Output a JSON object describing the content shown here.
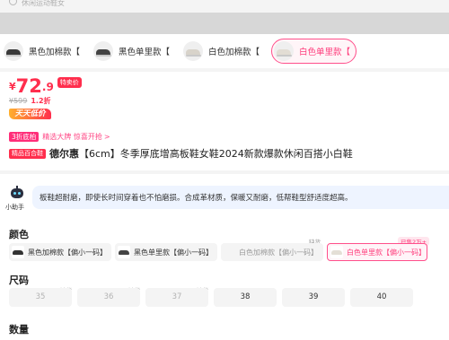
{
  "search": {
    "placeholder": "休闲运动鞋女"
  },
  "variant_strip": {
    "items": [
      {
        "label": "黑色加棉款【",
        "shoe_color": "#3a3a3a",
        "selected": false
      },
      {
        "label": "黑色单里款【",
        "shoe_color": "#444444",
        "selected": false
      },
      {
        "label": "白色加棉款【",
        "shoe_color": "#e8e4dc",
        "selected": false
      },
      {
        "label": "白色单里款【",
        "shoe_color": "#f2efe9",
        "selected": true
      }
    ]
  },
  "price": {
    "currency": "¥",
    "integer": "72",
    "decimal": ".9",
    "special_tag": "特卖价",
    "original": "¥599",
    "discount": "1.2折",
    "daily_low": "天天低价"
  },
  "promo": {
    "tag": "3折底柏",
    "text": "精选大牌 惊喜开抢",
    "arrow": ">"
  },
  "title": {
    "badge": "精品百合鞋",
    "brand": "德尔惠",
    "text": "【6cm】冬季厚底增高板鞋女鞋2024新款爆款休闲百搭小白鞋"
  },
  "assistant": {
    "name": "小助手",
    "message": "板鞋超耐磨，即使长时间穿着也不怕磨损。合成革材质，保暖又耐磨，低帮鞋型舒适度超高。"
  },
  "color_section": {
    "title": "颜色",
    "options": [
      {
        "label": "黑色加棉款【偏小一码】",
        "shoe_color": "#333333",
        "dim": false,
        "selected": false
      },
      {
        "label": "黑色单里款【偏小一码】",
        "shoe_color": "#444444",
        "dim": false,
        "selected": false
      },
      {
        "label": "白色加棉款【偏小一码】",
        "shoe_color": "#e6e2da",
        "dim": true,
        "selected": false
      },
      {
        "label": "白色单里款【偏小一码】",
        "shoe_color": "#efeae2",
        "dim": false,
        "selected": true
      }
    ],
    "stock_tag": "缺货",
    "sold_tag": "已售2万+"
  },
  "size_section": {
    "title": "尺码",
    "sizes": [
      {
        "label": "35",
        "dim": true
      },
      {
        "label": "36",
        "dim": true
      },
      {
        "label": "37",
        "dim": true
      },
      {
        "label": "38",
        "dim": false
      },
      {
        "label": "39",
        "dim": false
      },
      {
        "label": "40",
        "dim": false
      }
    ],
    "stock_tag": "缺货"
  },
  "quantity_section": {
    "title": "数量"
  },
  "colors": {
    "accent_pink": "#ff4f8b",
    "price_red": "#ff2e4d",
    "assistant_bg": "#eef4ff"
  }
}
